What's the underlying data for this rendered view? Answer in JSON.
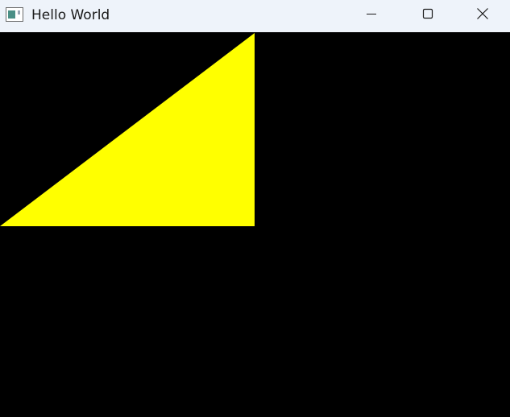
{
  "window": {
    "title": "Hello World",
    "controls": {
      "minimize_icon": "minimize-icon",
      "maximize_icon": "maximize-icon",
      "close_icon": "close-icon"
    }
  },
  "canvas": {
    "background_color": "#000000",
    "shape": "triangle",
    "shape_color": "#ffff00"
  },
  "colors": {
    "titlebar": "#eef3fa",
    "title_text": "#1a1a1a"
  }
}
